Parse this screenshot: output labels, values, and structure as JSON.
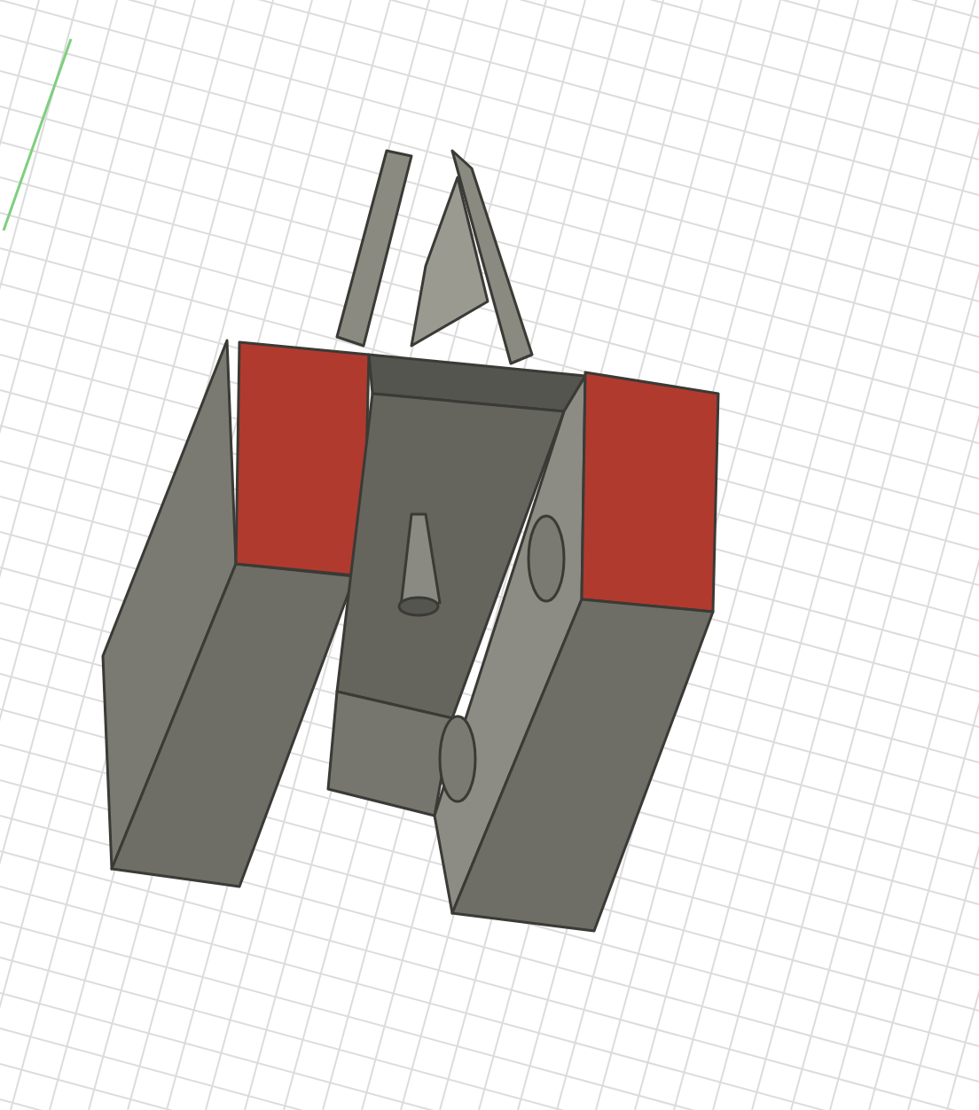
{
  "viewport": {
    "show_grid": true,
    "show_axis": true
  }
}
